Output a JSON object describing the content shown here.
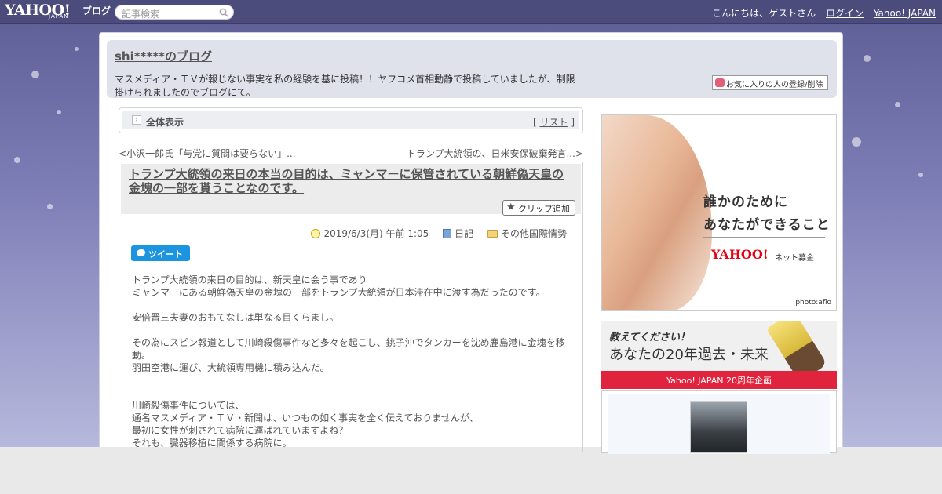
{
  "topbar": {
    "logo_main": "YAHOO!",
    "logo_sub": "JAPAN",
    "logo_blog": "ブログ",
    "search_placeholder": "記事検索",
    "greeting": "こんにちは、ゲストさん",
    "login": "ログイン",
    "yahoo_japan": "Yahoo! JAPAN"
  },
  "header": {
    "blog_title": "shi*****のブログ",
    "description": "マスメディア・ＴＶが報じない事実を私の経験を基に投稿！！ヤフコメ首相動静で投稿していましたが、制限掛けられましたのでブログにて。",
    "fav_button": "お気に入りの人の登録/削除"
  },
  "viewbar": {
    "label": "全体表示",
    "list_open": "[ ",
    "list": "リスト",
    "list_close": " ]"
  },
  "prevnext": {
    "prev_arrow": "<",
    "prev": "小沢一郎氏「与党に質問は要らない」",
    "prev_ellipsis": "...",
    "next": "トランプ大統領の、日米安保破棄発言...",
    "next_arrow": ">"
  },
  "article": {
    "title": "トランプ大統領の来日の本当の目的は、ミャンマーに保管されている朝鮮偽天皇の金塊の一部を貰うことなのです。",
    "clip_button": "クリップ追加",
    "date": "2019/6/3(月) 午前 1:05",
    "category": "日記",
    "folder": "その他国際情勢",
    "tweet": "ツイート",
    "body": [
      "トランプ大統領の来日の目的は、新天皇に会う事であり",
      "ミャンマーにある朝鮮偽天皇の金塊の一部をトランプ大統領が日本滞在中に渡す為だったのです。",
      "",
      "安倍晋三夫妻のおもてなしは単なる目くらまし。",
      "",
      "その為にスピン報道として川崎殺傷事件など多々を起こし、銚子沖でタンカーを沈め鹿島港に金塊を移動。",
      "羽田空港に運び、大統領専用機に積み込んだ。",
      "",
      "",
      "川崎殺傷事件については、",
      "通名マスメディア・ＴＶ・新聞は、いつもの如く事実を全く伝えておりませんが、",
      "最初に女性が刺されて病院に運ばれていますよね？",
      "それも、臓器移植に関係する病院に。"
    ]
  },
  "ads": {
    "ad1_line1": "誰かのために",
    "ad1_line2": "あなたができること",
    "ad1_logo": "YAHOO!",
    "ad1_logo_sub": "ネット募金",
    "ad1_credit": "photo:aflo",
    "ad2_line1": "教えてください！",
    "ad2_line2": "あなたの20年過去・未来",
    "ad2_bar": "Yahoo! JAPAN 20周年企画"
  }
}
